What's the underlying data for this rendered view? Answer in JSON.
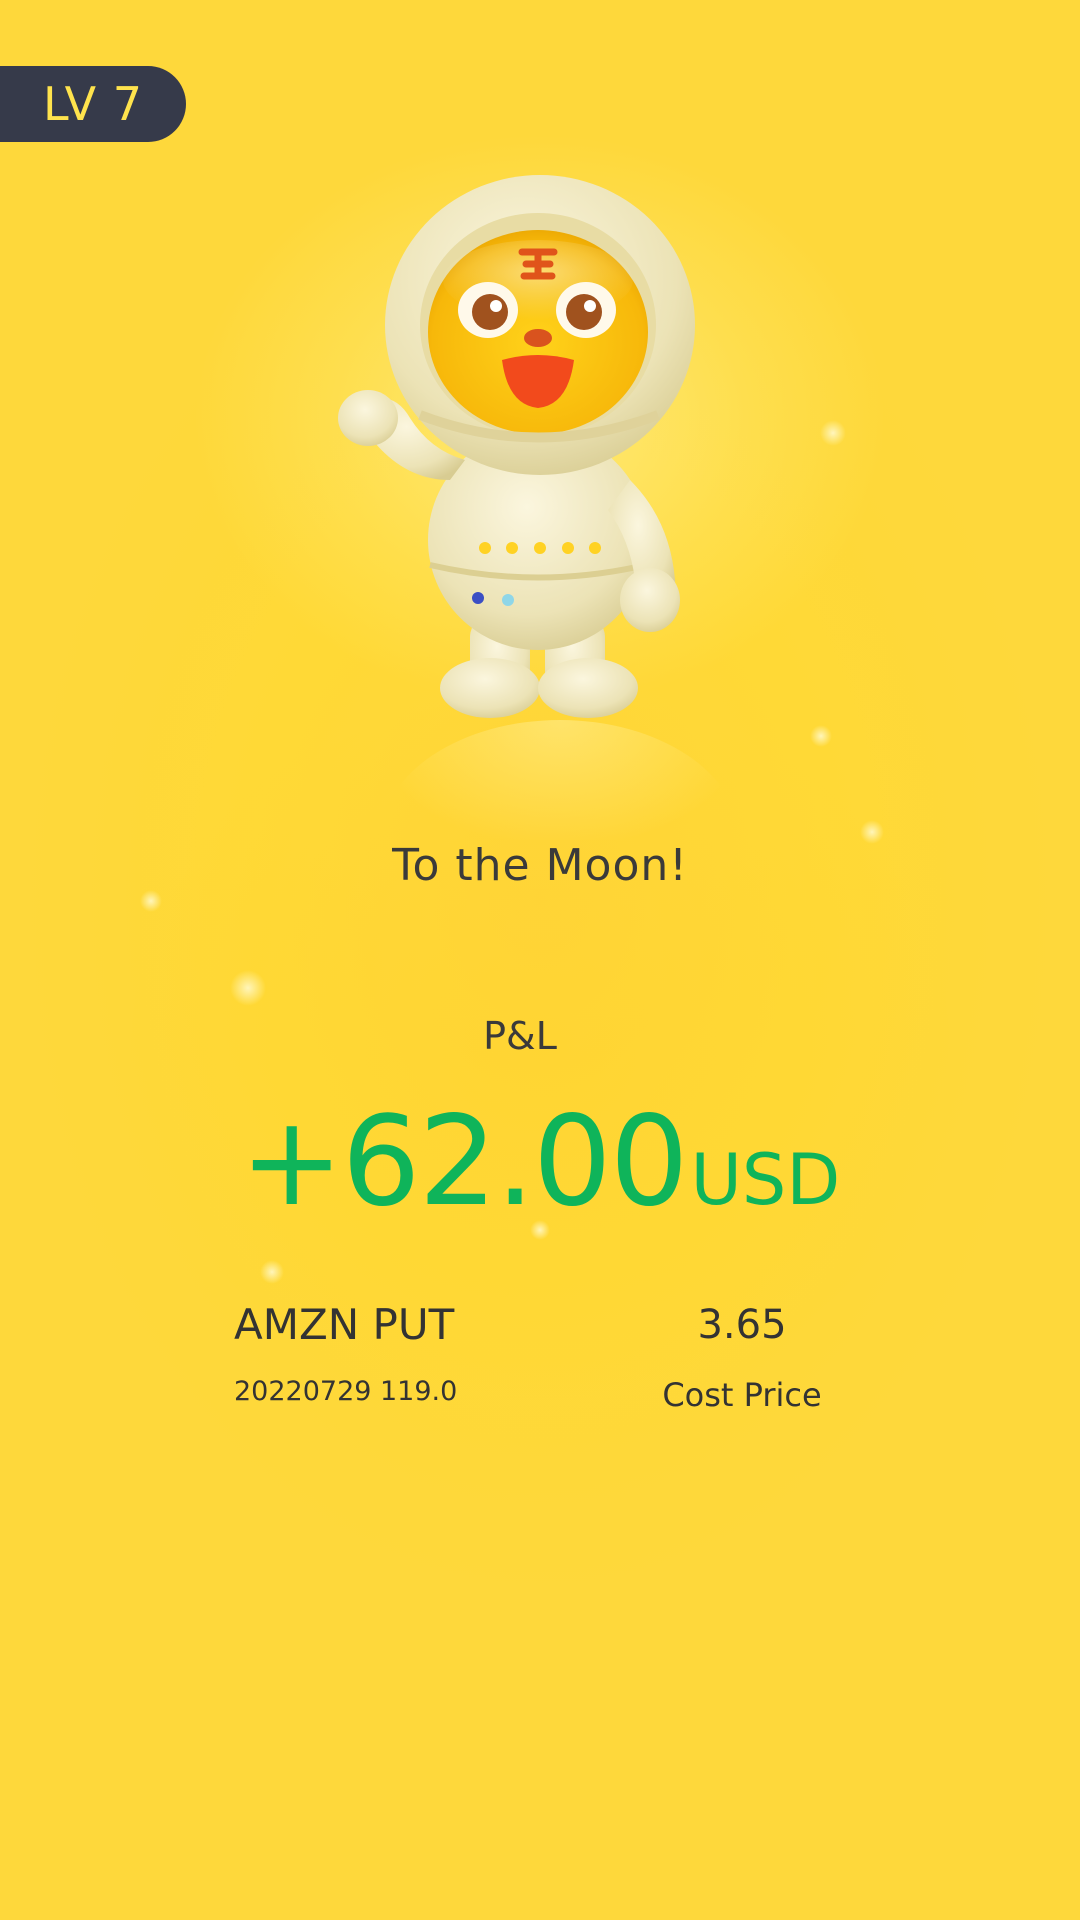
{
  "level": {
    "label": "LV 7"
  },
  "mascot": {
    "icon": "astronaut-tiger-mascot"
  },
  "headline": "To the Moon!",
  "pnl": {
    "label": "P&L",
    "amount": "+62.00",
    "currency": "USD"
  },
  "position": {
    "name": "AMZN PUT",
    "detail": "20220729 119.0",
    "cost_value": "3.65",
    "cost_label": "Cost Price"
  },
  "colors": {
    "background": "#fdd83a",
    "badge": "#363a4a",
    "badge_text": "#ffe34d",
    "profit": "#0fb45a",
    "text": "#333333"
  }
}
